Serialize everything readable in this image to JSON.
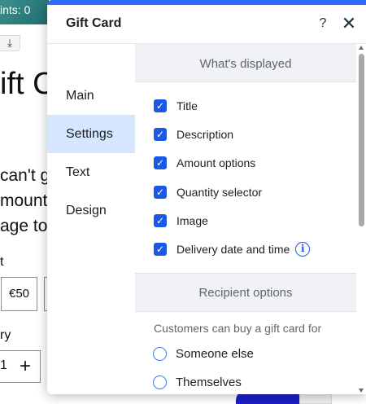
{
  "background": {
    "points_text": "ints: 0",
    "download_icon": "download-icon",
    "title_fragment": "ift C",
    "text_line_1": "can't ge",
    "text_line_2": "mount",
    "text_line_3": "age to",
    "amount_label": "t",
    "amount_value": "€50",
    "quantity_label": "ry",
    "quantity_value": "1",
    "plus_symbol": "+"
  },
  "panel": {
    "title": "Gift Card",
    "help_label": "?",
    "close_label": "✕",
    "accent_color": "#2f6bff"
  },
  "sidebar": {
    "items": [
      {
        "label": "Main",
        "active": false
      },
      {
        "label": "Settings",
        "active": true
      },
      {
        "label": "Text",
        "active": false
      },
      {
        "label": "Design",
        "active": false
      }
    ]
  },
  "content": {
    "displayed_section": {
      "title": "What's displayed",
      "options": [
        {
          "label": "Title",
          "checked": true
        },
        {
          "label": "Description",
          "checked": true
        },
        {
          "label": "Amount options",
          "checked": true
        },
        {
          "label": "Quantity selector",
          "checked": true
        },
        {
          "label": "Image",
          "checked": true
        },
        {
          "label": "Delivery date and time",
          "checked": true,
          "info_icon": "info-icon"
        }
      ]
    },
    "recipient_section": {
      "title": "Recipient options",
      "description": "Customers can buy a gift card for",
      "options": [
        {
          "label": "Someone else",
          "selected": false
        },
        {
          "label": "Themselves",
          "selected": false
        }
      ]
    }
  },
  "colors": {
    "checkbox": "#1a59e8",
    "active_nav": "#d5e6ff",
    "section_bg": "#f1f2f5"
  }
}
